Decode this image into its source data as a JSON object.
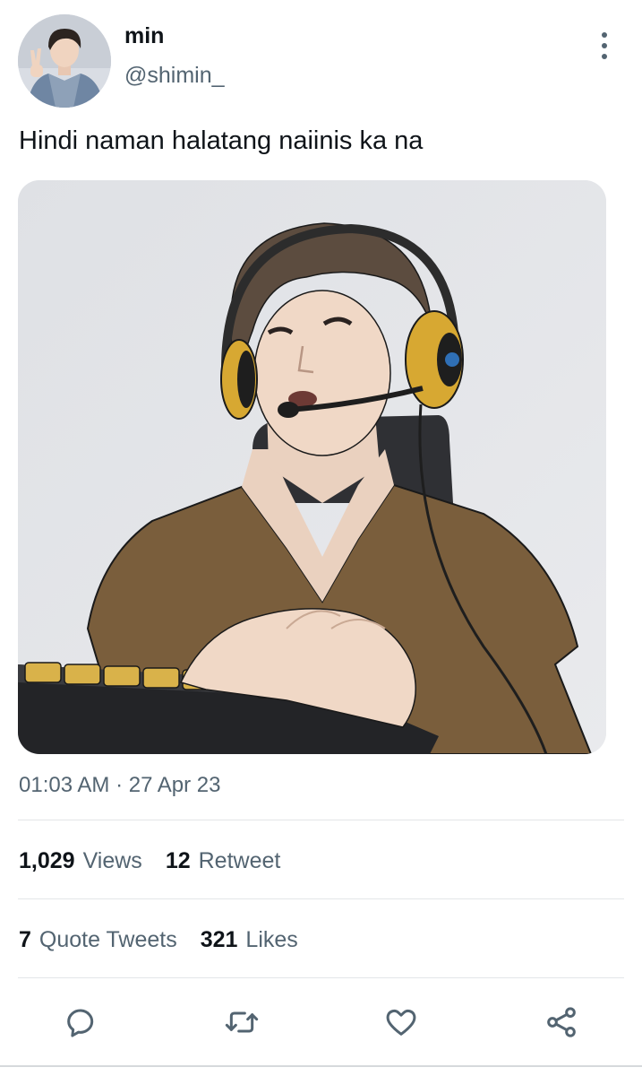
{
  "author": {
    "display_name": "min",
    "handle": "@shimin_"
  },
  "tweet": {
    "text": "Hindi naman halatang naiinis ka na",
    "timestamp": "01:03 AM · 27 Apr 23"
  },
  "stats": {
    "views_count": "1,029",
    "views_label": "Views",
    "retweets_count": "12",
    "retweets_label": "Retweet",
    "quotes_count": "7",
    "quotes_label": "Quote Tweets",
    "likes_count": "321",
    "likes_label": "Likes"
  },
  "actions": [
    "reply-icon",
    "retweet-icon",
    "like-icon",
    "share-icon"
  ],
  "colors": {
    "primary_text": "#0f1419",
    "secondary_text": "#536471",
    "divider": "#e3e6e8",
    "icon": "#536471"
  }
}
